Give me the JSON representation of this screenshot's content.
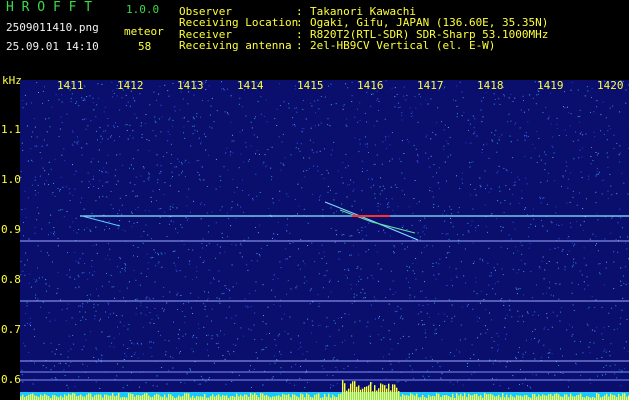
{
  "header": {
    "app_name": "H R O F F T",
    "version": "1.0.0",
    "filename": "2509011410.png",
    "datetime": "25.09.01 14:10",
    "meteor_label": "meteor",
    "meteor_count": "58"
  },
  "info": [
    {
      "key": "Observer",
      "sep": ":",
      "value": "Takanori Kawachi"
    },
    {
      "key": "Receiving Location",
      "sep": ":",
      "value": "Ogaki, Gifu, JAPAN (136.60E, 35.35N)"
    },
    {
      "key": "Receiver",
      "sep": ":",
      "value": "R820T2(RTL-SDR) SDR-Sharp 53.1000MHz"
    },
    {
      "key": "Receiving antenna",
      "sep": ":",
      "value": "2el-HB9CV Vertical (el. E-W)"
    }
  ],
  "spectrogram": {
    "y_unit": "kHz",
    "x_ticks": [
      "1411",
      "1412",
      "1413",
      "1414",
      "1415",
      "1416",
      "1417",
      "1418",
      "1419",
      "1420"
    ],
    "y_ticks": [
      "1.1",
      "1.0",
      "0.9",
      "0.8",
      "0.7",
      "0.6"
    ],
    "colors": {
      "background": "#0a0f6e",
      "noise": "#2b5cff",
      "signal_line": "#8fe8ff",
      "meteor_hot": "#ff3030",
      "level_bar": "#ffff3a",
      "level_base": "#18c8ff"
    }
  }
}
